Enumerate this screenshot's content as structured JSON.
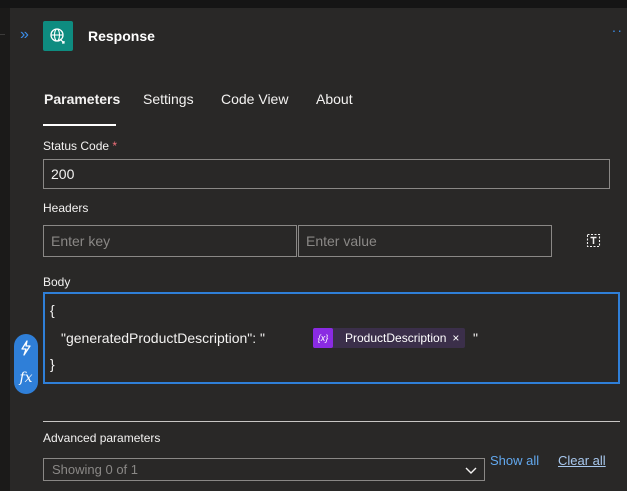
{
  "header": {
    "expand_glyph": "»",
    "title": "Response",
    "more_glyph": "··"
  },
  "tabs": [
    {
      "label": "Parameters",
      "active": true
    },
    {
      "label": "Settings",
      "active": false
    },
    {
      "label": "Code View",
      "active": false
    },
    {
      "label": "About",
      "active": false
    }
  ],
  "status_code": {
    "label": "Status Code",
    "required_mark": "*",
    "value": "200"
  },
  "headers": {
    "label": "Headers",
    "key_placeholder": "Enter key",
    "value_placeholder": "Enter value",
    "mode_icon": "text-mode-icon"
  },
  "body": {
    "label": "Body",
    "line1": "{",
    "line2_prefix": "\"generatedProductDescription\": \"",
    "token_label": "ProductDescription",
    "token_remove": "×",
    "line2_suffix": "\"",
    "line3": "}",
    "token_icon_text": "{x}"
  },
  "side_buttons": {
    "dynamic_content_icon": "lightning-icon",
    "expression_label": "fx"
  },
  "advanced": {
    "label": "Advanced parameters",
    "select_value": "Showing 0 of 1",
    "show_all": "Show all",
    "clear_all": "Clear all"
  },
  "colors": {
    "accent": "#2f7fd8",
    "token": "#8a2be2",
    "app_icon": "#0e8c80"
  }
}
